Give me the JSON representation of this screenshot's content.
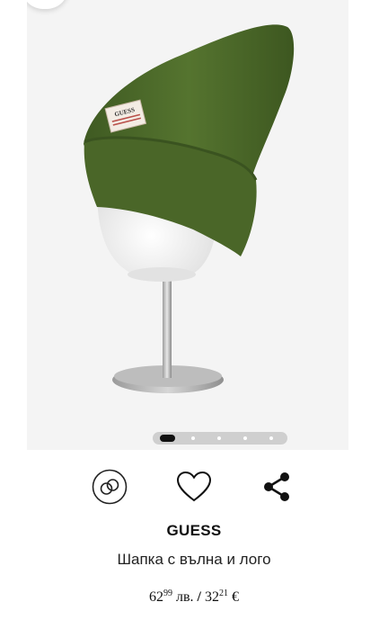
{
  "product": {
    "brand": "GUESS",
    "name": "Шапка с вълна и лого",
    "label_text": "GUESS"
  },
  "gallery": {
    "image_count": 5,
    "active_index": 0,
    "image_icon": "beanie-on-mannequin"
  },
  "actions": {
    "compare_icon": "linked-rings-icon",
    "wishlist_icon": "heart-icon",
    "share_icon": "share-icon"
  },
  "price": {
    "bgn_whole": "62",
    "bgn_fraction": "99",
    "bgn_currency": "лв.",
    "separator": "/",
    "eur_whole": "32",
    "eur_fraction": "21",
    "eur_currency": "€"
  },
  "colors": {
    "beanie": "#4e6b2c",
    "gallery_bg": "#f4f4f4",
    "active_dot": "#111111"
  }
}
